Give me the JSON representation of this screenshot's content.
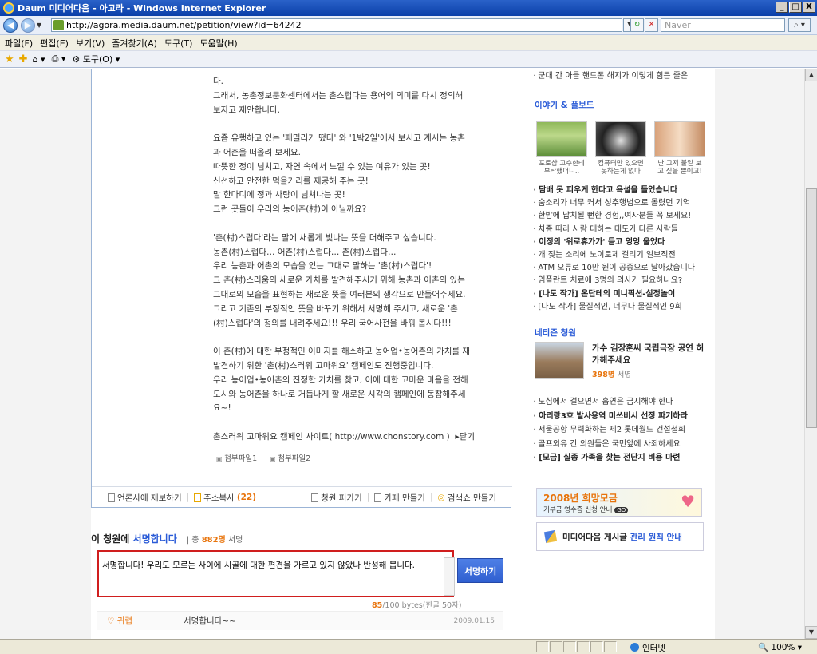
{
  "window": {
    "title": "Daum 미디어다음 - 아고라 - Windows Internet Explorer",
    "min": "_",
    "max": "□",
    "close": "X"
  },
  "address": {
    "url": "http://agora.media.daum.net/petition/view?id=64242",
    "search_placeholder": "Naver"
  },
  "menu": [
    "파일(F)",
    "편집(E)",
    "보기(V)",
    "즐겨찾기(A)",
    "도구(T)",
    "도움말(H)"
  ],
  "favbar": {
    "tools_label": "도구(O)"
  },
  "petition": {
    "lines": [
      "다.",
      "그래서, 농촌정보문화센터에서는 촌스럽다는 용어의 의미를 다시 정의해",
      "보자고 제안합니다.",
      "",
      "요즘 유행하고 있는 '패밀리가 떴다' 와 '1박2일'에서 보시고 계시는 농촌",
      "과 어촌을 떠올려 보세요.",
      "따뜻한 정이 넘치고, 자연 속에서 느낄 수 있는 여유가 있는 곳!",
      "신선하고 안전한 먹을거리를 제공해 주는 곳!",
      "말 한마디에 정과 사랑이 넘쳐나는 곳!",
      "그런 곳들이 우리의 농어촌(村)이 아닐까요?",
      "",
      "'촌(村)스럽다'라는 말에 새롭게 빛나는 뜻을 더해주고 싶습니다.",
      "농촌(村)스럽다… 어촌(村)스럽다… 촌(村)스럽다…",
      "우리 농촌과 어촌의 모습을 있는 그대로 말하는 '촌(村)스럽다'!",
      "그 촌(村)스러움의 새로운 가치를 발견해주시기 위해 농촌과 어촌의 있는",
      "그대로의 모습을 표현하는 새로운 뜻을 여러분의 생각으로 만들어주세요.",
      "그리고 기존의 부정적인 뜻을 바꾸기 위해서 서명해 주시고, 새로운 '촌",
      "(村)스럽다'의 정의를 내려주세요!!! 우리 국어사전을 바꿔 봅시다!!!",
      "",
      "이 촌(村)에 대한 부정적인 이미지를 해소하고 농어업•농어촌의 가치를 재",
      "발견하기 위한 '촌(村)스러워 고마워요' 캠페인도 진행중입니다.",
      "우리 농어업•농어촌의 진정한 가치를 찾고, 이에 대한 고마운 마음을 전해",
      "도시와 농어촌을 하나로 거듭나게 할 새로운 시각의 캠페인에 동참해주세",
      "요~!",
      "",
      "촌스러워 고마워요 캠페인 사이트( http://www.chonstory.com )  ▸닫기"
    ],
    "attachments": [
      "첨부파일1",
      "첨부파일2"
    ],
    "toolbar": {
      "report": "언론사에 제보하기",
      "address_copy": "주소복사",
      "address_copy_count": "(22)",
      "spread": "청원 퍼가기",
      "cafe": "카페 만들기",
      "search": "검색쇼 만들기"
    }
  },
  "sign": {
    "title_prefix": "이 청원에",
    "title_highlight": "서명합니다",
    "total_prefix": "총",
    "total_count": "882명",
    "total_suffix": "서명",
    "input_text": "서명합니다!  우리도 모르는 사이에 시골에 대한 편견을 가르고 있지 않았나 반성해 봅니다.",
    "button": "서명하기",
    "bytes_used": "85",
    "bytes_rest": "/100 bytes(한글 50자)",
    "entry": {
      "author": "♡ 귀렵",
      "message": "서명합니다~~",
      "date": "2009.01.15"
    }
  },
  "right": {
    "top_item": "군대 간 아들 핸드폰 해지가 이렇게 힘든 줄은",
    "story_title": "이야기 & 플보드",
    "thumbs": [
      {
        "caption1": "포토샵 고수한테",
        "caption2": "부탁했더니.."
      },
      {
        "caption1": "컴퓨터만 있으면",
        "caption2": "못하는게 없다"
      },
      {
        "caption1": "난 그저 불일 보",
        "caption2": "고 싶을 뿐이고!"
      }
    ],
    "story_list": [
      {
        "text": "담배 못 피우게 한다고 욕설을 들었습니다",
        "bold": true
      },
      {
        "text": "숨소리가 너무 커서 성추행범으로 몰렸던 기억",
        "bold": false
      },
      {
        "text": "한밤에 납치될 뻔한 경험,,여자분들 꼭 보세요!",
        "bold": false
      },
      {
        "text": "차종 따라 사람 대하는 태도가 다른 사람들",
        "bold": false
      },
      {
        "text": "이정의 '위로휴가가' 듣고 엉엉 울었다",
        "bold": true
      },
      {
        "text": "개 짖는 소리에 노이로제 걸리기 일보직전",
        "bold": false
      },
      {
        "text": "ATM 오류로 10만 원이 공중으로 날아갔습니다",
        "bold": false
      },
      {
        "text": "임플란트 치료에 3명의 의사가 필요하나요?",
        "bold": false
      },
      {
        "text": "[나도 작가] 온단테의 미니픽션-설정놀이",
        "bold": true
      },
      {
        "text": "[나도 작가] 물질적인, 너무나 물질적인 9회",
        "bold": false
      }
    ],
    "netizen_title": "네티즌 청원",
    "netizen_feature": {
      "title": "가수 김장훈씨 국립극장 공연 허가해주세요",
      "count": "398명",
      "count_suffix": "서명"
    },
    "netizen_list": [
      {
        "text": "도심에서 걸으면서 흡연은 금지해야 한다",
        "bold": false
      },
      {
        "text": "아리랑3호 발사용역 미쓰비시 선정 파기하라",
        "bold": true
      },
      {
        "text": "서울공항 무력화하는 제2 롯데월드 건설철회",
        "bold": false
      },
      {
        "text": "골프외유 간 의원들은 국민앞에 사죄하세요",
        "bold": false
      },
      {
        "text": "[모금] 실종 가족을 찾는 전단지 비용 마련",
        "bold": true
      }
    ],
    "banner": {
      "title": "2008년 희망모금",
      "subtitle": "기부금 영수증 신청 안내",
      "go": "GO"
    },
    "notice": {
      "prefix": "미디어다음 게시글",
      "highlight": "관리 원칙 안내"
    }
  },
  "status": {
    "zone": "인터넷",
    "zoom": "100%"
  }
}
